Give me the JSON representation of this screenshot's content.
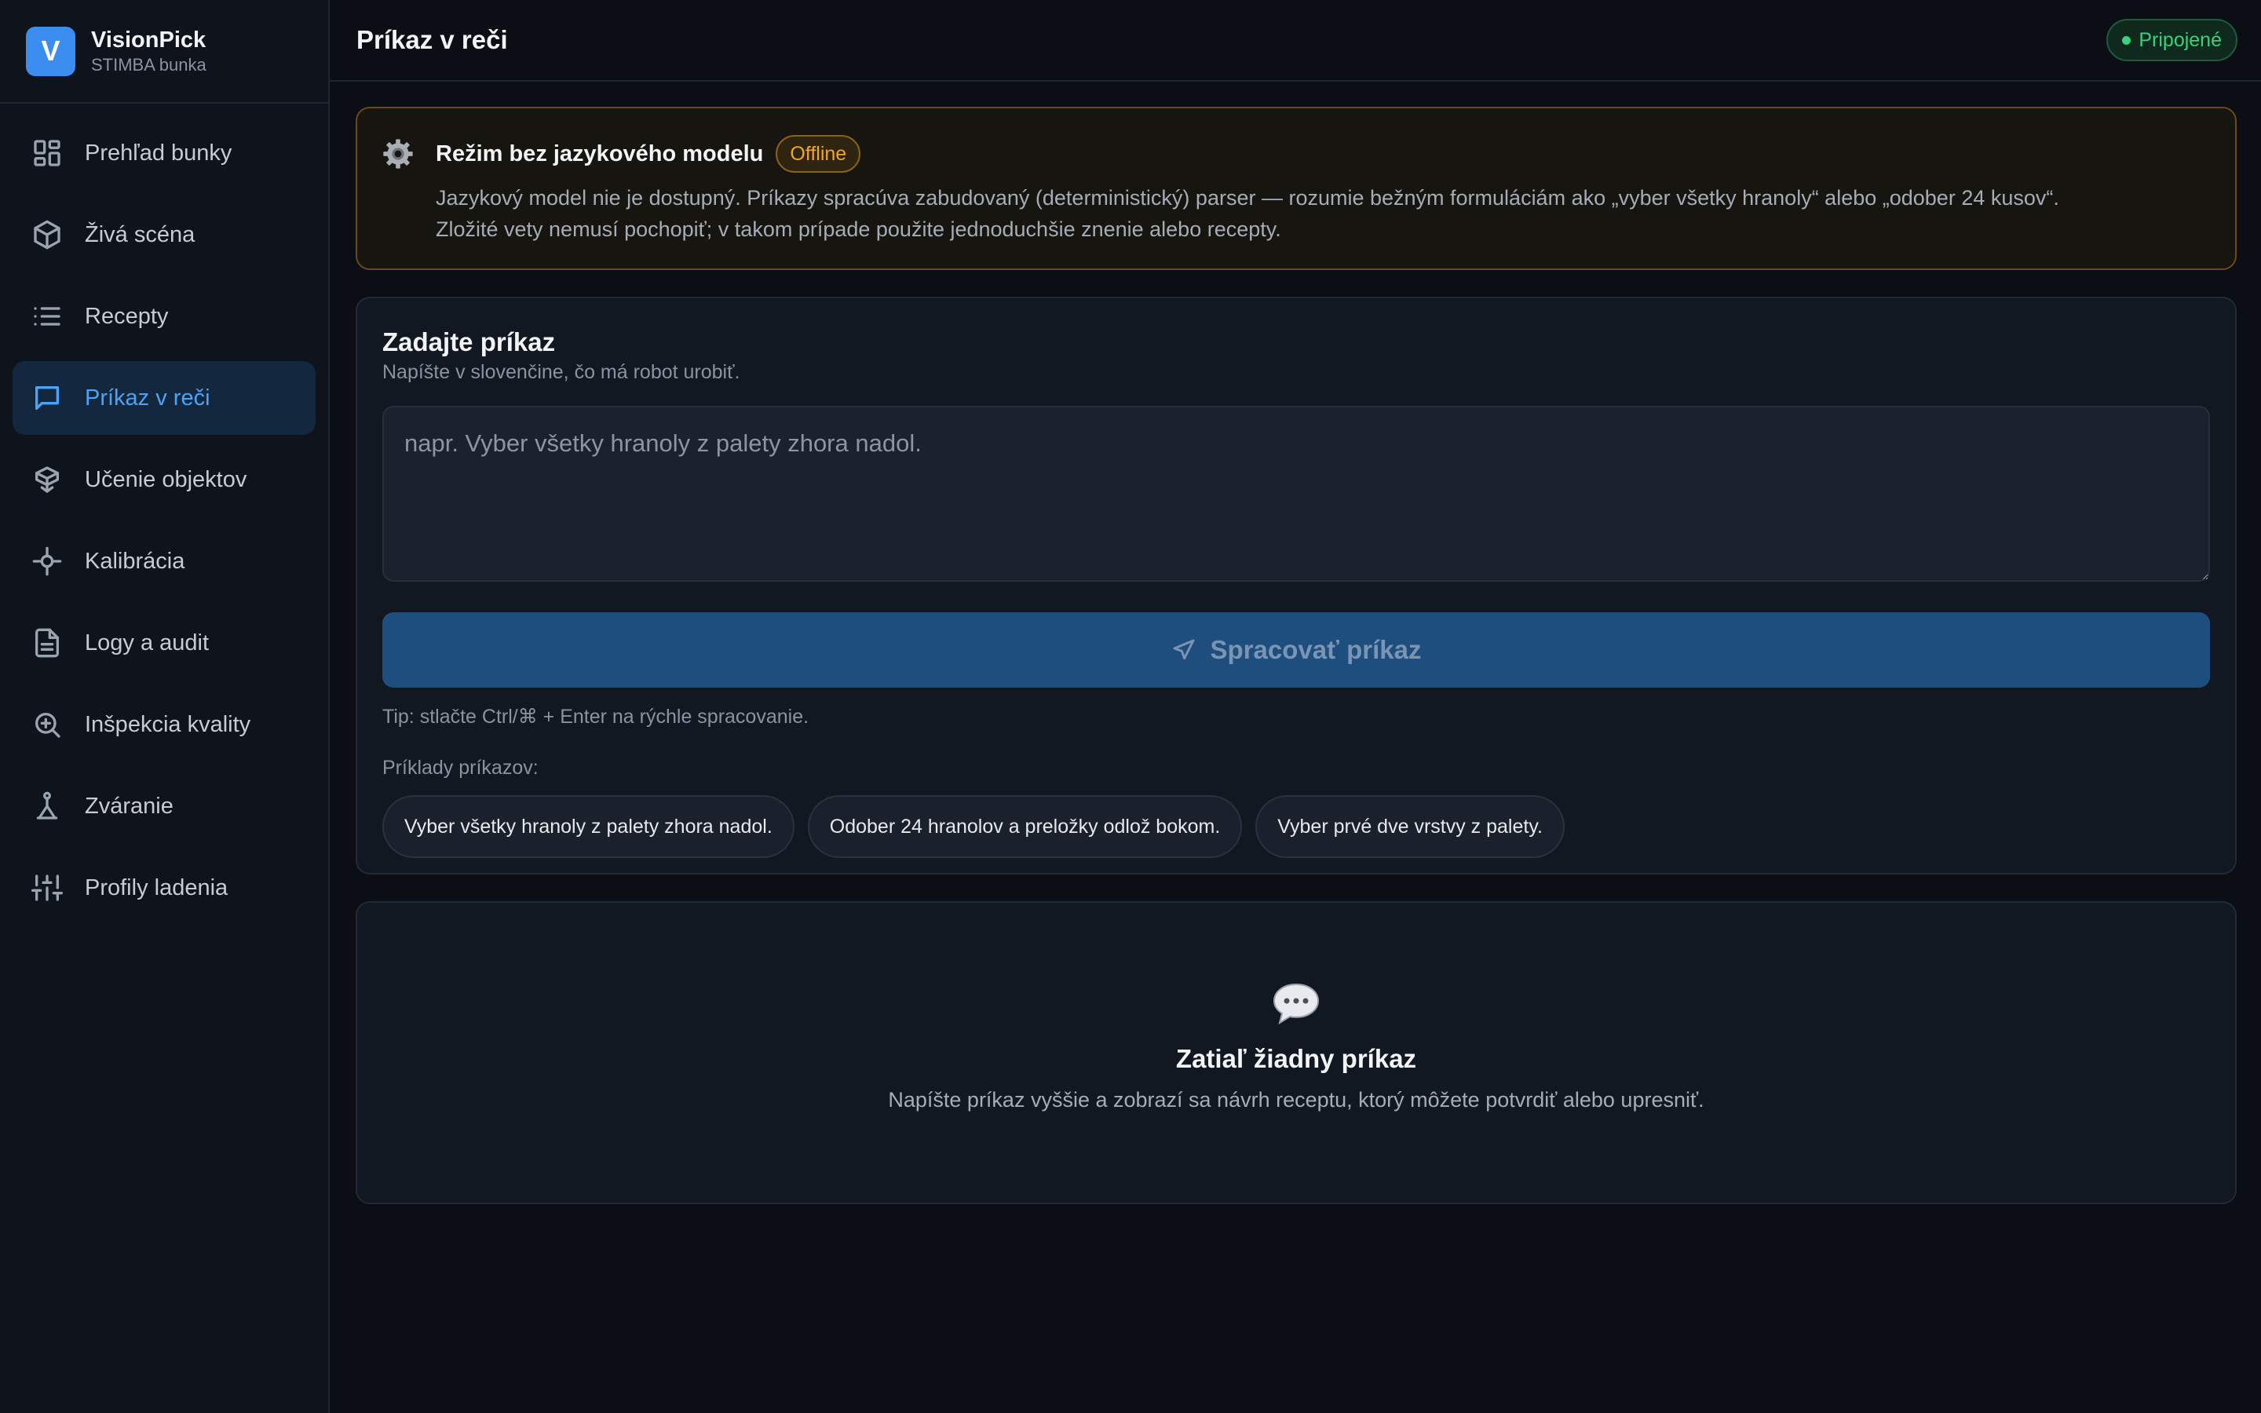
{
  "brand": {
    "logo_letter": "V",
    "name": "VisionPick",
    "subtitle": "STIMBA bunka",
    "accent": "#3b8ef0"
  },
  "sidebar": {
    "items": [
      {
        "label": "Prehľad bunky",
        "icon": "dashboard-icon",
        "active": false
      },
      {
        "label": "Živá scéna",
        "icon": "cube-icon",
        "active": false
      },
      {
        "label": "Recepty",
        "icon": "list-icon",
        "active": false
      },
      {
        "label": "Príkaz v reči",
        "icon": "message-icon",
        "active": true
      },
      {
        "label": "Učenie objektov",
        "icon": "package-icon",
        "active": false
      },
      {
        "label": "Kalibrácia",
        "icon": "crosshair-icon",
        "active": false
      },
      {
        "label": "Logy a audit",
        "icon": "file-text-icon",
        "active": false
      },
      {
        "label": "Inšpekcia kvality",
        "icon": "zoom-in-icon",
        "active": false
      },
      {
        "label": "Zváranie",
        "icon": "weld-torch-icon",
        "active": false
      },
      {
        "label": "Profily ladenia",
        "icon": "sliders-icon",
        "active": false
      }
    ]
  },
  "header": {
    "title": "Príkaz v reči",
    "status": "Pripojené",
    "status_color": "#3ccf7e"
  },
  "alert": {
    "icon": "gear-icon",
    "title": "Režim bez jazykového modelu",
    "badge": "Offline",
    "line1": "Jazykový model nie je dostupný. Príkazy spracúva zabudovaný (deterministický) parser — rozumie bežným formuláciám ako „vyber všetky hranoly“ alebo „odober 24 kusov“.",
    "line2": "Zložité vety nemusí pochopiť; v takom prípade použite jednoduchšie znenie alebo recepty."
  },
  "command": {
    "title": "Zadajte príkaz",
    "subtitle": "Napíšte v slovenčine, čo má robot urobiť.",
    "placeholder": "napr. Vyber všetky hranoly z palety zhora nadol.",
    "value": "",
    "submit_label": "Spracovať príkaz",
    "tip": "Tip: stlačte Ctrl/⌘ + Enter na rýchle spracovanie.",
    "examples_label": "Príklady príkazov:",
    "examples": [
      "Vyber všetky hranoly z palety zhora nadol.",
      "Odober 24 hranolov a preložky odlož bokom.",
      "Vyber prvé dve vrstvy z palety."
    ]
  },
  "empty": {
    "icon": "speech-bubble-icon",
    "title": "Zatiaľ žiadny príkaz",
    "description": "Napíšte príkaz vyššie a zobrazí sa návrh receptu, ktorý môžete potvrdiť alebo upresniť."
  }
}
